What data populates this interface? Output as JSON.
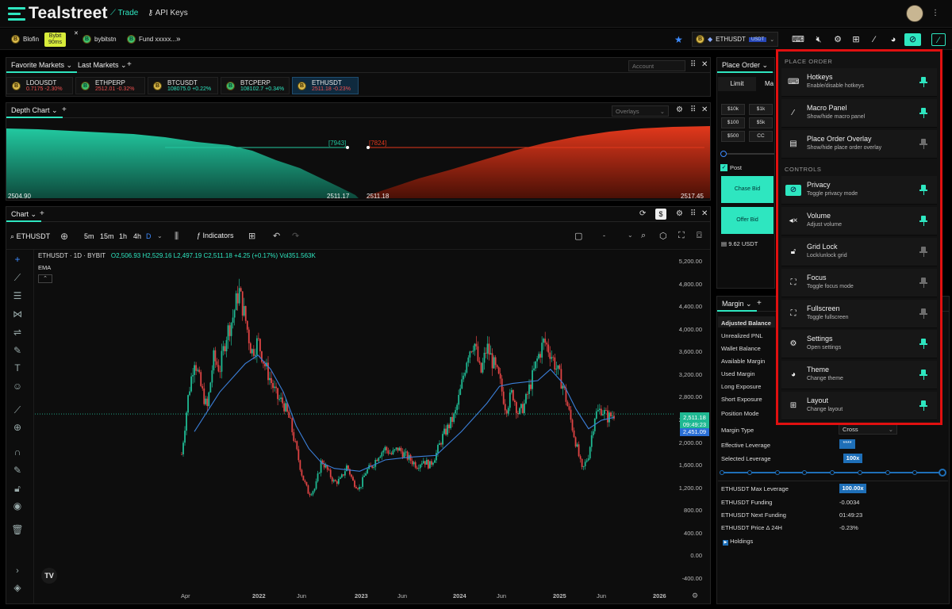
{
  "app": {
    "name": "Tealstreet"
  },
  "nav": {
    "trade": "Trade",
    "api_keys": "API Keys"
  },
  "accounts": [
    {
      "name": "Blofin"
    },
    {
      "name": "Bybit",
      "badge": "90ms"
    },
    {
      "name": "bybitstn"
    },
    {
      "name": "Fund xxxxx..."
    }
  ],
  "symbol_bar": {
    "symbol": "ETHUSDT",
    "tag": "USDT"
  },
  "markets_panel": {
    "tab1": "Favorite Markets",
    "tab2": "Last Markets",
    "account_placeholder": "Account"
  },
  "markets": [
    {
      "name": "LDOUSDT",
      "price": "0.7175",
      "change": "-2.30%"
    },
    {
      "name": "ETHPERP",
      "price": "2512.01",
      "change": "-0.32%"
    },
    {
      "name": "BTCUSDT",
      "price": "108075.0",
      "change": "+0.22%"
    },
    {
      "name": "BTCPERP",
      "price": "108102.7",
      "change": "+0.34%"
    },
    {
      "name": "ETHUSDT",
      "price": "2511.18",
      "change": "-0.23%"
    }
  ],
  "depth": {
    "title": "Depth Chart",
    "overlays": "Overlays",
    "bid_qty": "[7943]",
    "ask_qty": "[7824]",
    "low": "2504.90",
    "bid": "2511.17",
    "ask": "2511.18",
    "high": "2517.45"
  },
  "chart": {
    "tab": "Chart",
    "symbol": "ETHUSDT",
    "intervals": [
      "5m",
      "15m",
      "1h",
      "4h",
      "D"
    ],
    "indicators": "Indicators",
    "legend": "ETHUSDT · 1D · BYBIT",
    "o": "O2,506.93",
    "h": "H2,529.16",
    "l": "L2,497.19",
    "c": "C2,511.18",
    "chg": "+4.25 (+0.17%)",
    "vol": "Vol351.563K",
    "ema": "EMA",
    "dash": "-",
    "price_label": "2,511.18",
    "countdown": "09:49:23",
    "ema_label": "2,451.09"
  },
  "chart_data": {
    "type": "candlestick",
    "y_ticks": [
      "5,200.00",
      "4,800.00",
      "4,400.00",
      "4,000.00",
      "3,600.00",
      "3,200.00",
      "2,800.00",
      "2,400.00",
      "2,000.00",
      "1,600.00",
      "1,200.00",
      "800.00",
      "400.00",
      "0.00",
      "-400.00"
    ],
    "x_ticks": [
      "Apr",
      "2022",
      "Jun",
      "2023",
      "Jun",
      "2024",
      "Jun",
      "2025",
      "Jun",
      "2026"
    ],
    "ylim": [
      -400,
      5200
    ],
    "close_path": [
      [
        0,
        1800
      ],
      [
        0.5,
        2800
      ],
      [
        1,
        3500
      ],
      [
        1.5,
        3000
      ],
      [
        2,
        2600
      ],
      [
        2.5,
        3500
      ],
      [
        3,
        3300
      ],
      [
        3.5,
        3900
      ],
      [
        4,
        4200
      ],
      [
        4.5,
        4700
      ],
      [
        5,
        4200
      ],
      [
        5.5,
        3600
      ],
      [
        6,
        3800
      ],
      [
        6.5,
        3400
      ],
      [
        7,
        3100
      ],
      [
        7.5,
        2800
      ],
      [
        8,
        2700
      ],
      [
        8.5,
        2400
      ],
      [
        9,
        1900
      ],
      [
        9.5,
        1400
      ],
      [
        10,
        1100
      ],
      [
        10.5,
        1200
      ],
      [
        11,
        1700
      ],
      [
        11.5,
        1500
      ],
      [
        12,
        1300
      ],
      [
        12.5,
        1350
      ],
      [
        13,
        1600
      ],
      [
        13.5,
        1300
      ],
      [
        14,
        1200
      ],
      [
        14.5,
        1500
      ],
      [
        15,
        1600
      ],
      [
        15.5,
        1800
      ],
      [
        16,
        1900
      ],
      [
        16.5,
        1800
      ],
      [
        17,
        1900
      ],
      [
        17.5,
        1800
      ],
      [
        18,
        1700
      ],
      [
        18.5,
        1600
      ],
      [
        19,
        1700
      ],
      [
        19.5,
        1600
      ],
      [
        20,
        1800
      ],
      [
        20.5,
        2100
      ],
      [
        21,
        2300
      ],
      [
        21.5,
        2500
      ],
      [
        22,
        3000
      ],
      [
        22.5,
        3600
      ],
      [
        23,
        3800
      ],
      [
        23.5,
        3200
      ],
      [
        24,
        3700
      ],
      [
        24.5,
        3400
      ],
      [
        25,
        3100
      ],
      [
        25.5,
        2600
      ],
      [
        26,
        2900
      ],
      [
        26.5,
        2500
      ],
      [
        27,
        2700
      ],
      [
        27.5,
        3100
      ],
      [
        28,
        3500
      ],
      [
        28.5,
        3800
      ],
      [
        29,
        3600
      ],
      [
        29.5,
        3300
      ],
      [
        30,
        3000
      ],
      [
        30.5,
        2500
      ],
      [
        31,
        2000
      ],
      [
        31.5,
        1500
      ],
      [
        32,
        1800
      ],
      [
        32.5,
        2500
      ],
      [
        33,
        2600
      ],
      [
        33.5,
        2450
      ],
      [
        34,
        2511
      ]
    ],
    "ema_path": [
      [
        1,
        2200
      ],
      [
        3,
        2900
      ],
      [
        5,
        3400
      ],
      [
        6,
        3550
      ],
      [
        7,
        3300
      ],
      [
        8,
        2900
      ],
      [
        9,
        2300
      ],
      [
        10,
        1900
      ],
      [
        11,
        1650
      ],
      [
        12,
        1550
      ],
      [
        14,
        1500
      ],
      [
        16,
        1700
      ],
      [
        18,
        1750
      ],
      [
        20,
        1780
      ],
      [
        22,
        2200
      ],
      [
        24,
        2700
      ],
      [
        25,
        3000
      ],
      [
        26,
        3050
      ],
      [
        28,
        3100
      ],
      [
        29,
        3300
      ],
      [
        30,
        3050
      ],
      [
        31,
        2600
      ],
      [
        32,
        2250
      ],
      [
        33,
        2400
      ],
      [
        34,
        2451
      ]
    ]
  },
  "place_order": {
    "title": "Place Order",
    "tabs": [
      "Limit",
      "Ma"
    ],
    "presets": [
      "$10k",
      "$1k",
      "$100",
      "$5k",
      "$500",
      "CC"
    ],
    "post": "Post",
    "chase_bid": "Chase Bid",
    "offer_bid": "Offer Bid",
    "balance": "9.62 USDT"
  },
  "margin": {
    "title": "Margin",
    "rows": [
      {
        "label": "Adjusted Balance",
        "value": ""
      },
      {
        "label": "Unrealized PNL",
        "value": ""
      },
      {
        "label": "Wallet Balance",
        "value": ""
      },
      {
        "label": "Available Margin",
        "value": ""
      },
      {
        "label": "Used Margin",
        "value": ""
      },
      {
        "label": "Long Exposure",
        "value": ""
      },
      {
        "label": "Short Exposure",
        "value": ""
      },
      {
        "label": "Position Mode",
        "value": ""
      }
    ],
    "margin_type_label": "Margin Type",
    "margin_type": "Cross",
    "eff_lev_label": "Effective Leverage",
    "eff_lev": "****",
    "sel_lev_label": "Selected Leverage",
    "sel_lev": "100x",
    "leverage_fraction": 1.0,
    "max_lev_label": "ETHUSDT Max Leverage",
    "max_lev": "100.00x",
    "funding_label": "ETHUSDT Funding",
    "funding": "-0.0034",
    "next_funding_label": "ETHUSDT Next Funding",
    "next_funding": "01:49:23",
    "price_delta_label": "ETHUSDT Price Δ 24H",
    "price_delta": "-0.23%",
    "holdings": "Holdings"
  },
  "dropdown": {
    "section1": "PLACE ORDER",
    "section2": "CONTROLS",
    "items": [
      {
        "title": "Hotkeys",
        "sub": "Enable/disable hotkeys",
        "icon": "keyboard-icon",
        "pinned": true
      },
      {
        "title": "Macro Panel",
        "sub": "Show/hide macro panel",
        "icon": "magic-wand-icon",
        "pinned": true
      },
      {
        "title": "Place Order Overlay",
        "sub": "Show/hide place order overlay",
        "icon": "overlay-icon",
        "pinned": false
      },
      {
        "title": "Privacy",
        "sub": "Toggle privacy mode",
        "icon": "eye-off-icon",
        "pinned": true
      },
      {
        "title": "Volume",
        "sub": "Adjust volume",
        "icon": "volume-mute-icon",
        "pinned": true
      },
      {
        "title": "Grid Lock",
        "sub": "Lock/unlock grid",
        "icon": "unlock-icon",
        "pinned": false
      },
      {
        "title": "Focus",
        "sub": "Toggle focus mode",
        "icon": "focus-icon",
        "pinned": false
      },
      {
        "title": "Fullscreen",
        "sub": "Toggle fullscreen",
        "icon": "fullscreen-icon",
        "pinned": false
      },
      {
        "title": "Settings",
        "sub": "Open settings",
        "icon": "gear-icon",
        "pinned": true
      },
      {
        "title": "Theme",
        "sub": "Change theme",
        "icon": "palette-icon",
        "pinned": true
      },
      {
        "title": "Layout",
        "sub": "Change layout",
        "icon": "layout-grid-icon",
        "pinned": true
      }
    ]
  },
  "colors": {
    "accent": "#2ee6c0",
    "bid": "#1fb892",
    "ask": "#d8341c",
    "highlight_border": "#e01010"
  }
}
